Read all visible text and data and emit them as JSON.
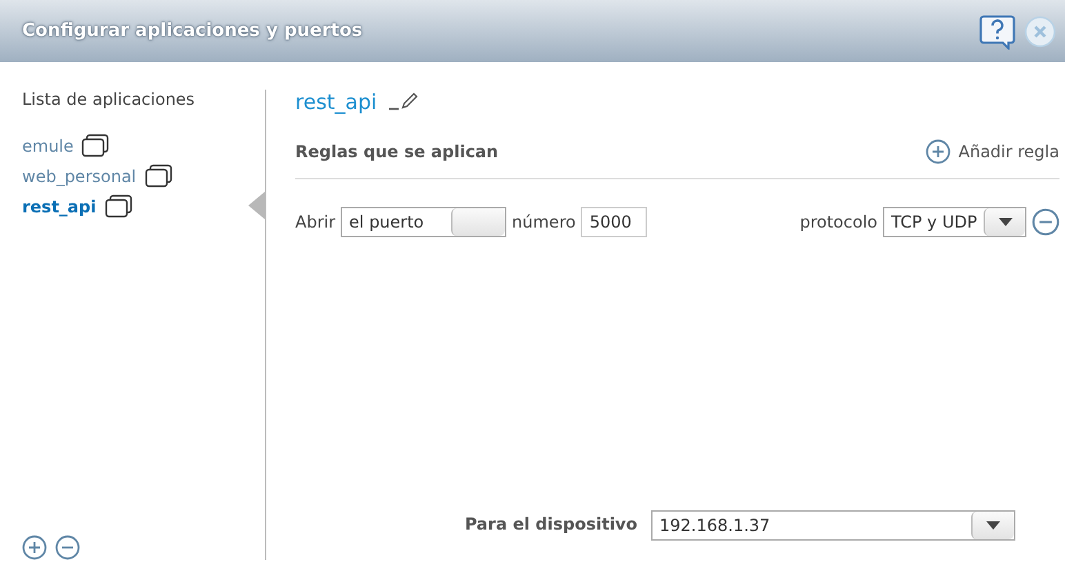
{
  "window": {
    "title": "Configurar aplicaciones y puertos"
  },
  "sidebar": {
    "heading": "Lista de aplicaciones",
    "items": [
      {
        "label": "emule",
        "selected": false
      },
      {
        "label": "web_personal",
        "selected": false
      },
      {
        "label": "rest_api",
        "selected": true
      }
    ]
  },
  "app": {
    "name": "rest_api",
    "rules_heading": "Reglas que se aplican",
    "add_rule": "Añadir regla",
    "rules": [
      {
        "open_label": "Abrir",
        "target": "el puerto",
        "number_label": "número",
        "number": "5000",
        "protocol_label": "protocolo",
        "protocol": "TCP y UDP"
      }
    ],
    "device_label": "Para el dispositivo",
    "device": "192.168.1.37"
  }
}
